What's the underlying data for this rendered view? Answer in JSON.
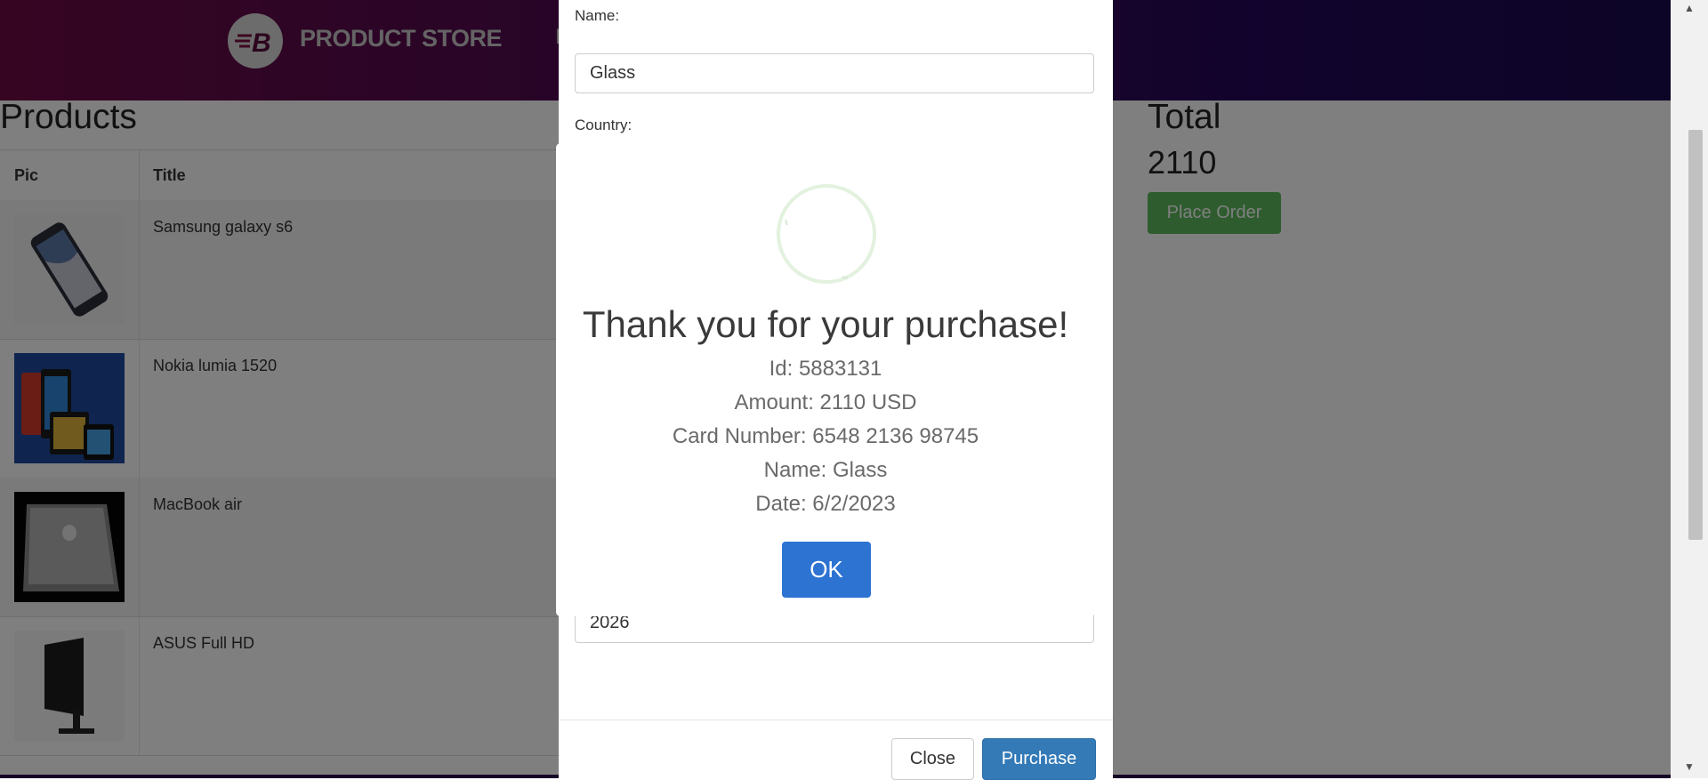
{
  "header": {
    "brand": "PRODUCT STORE",
    "nav_stub": "H",
    "logo_letter": "B"
  },
  "products": {
    "title": "Products",
    "columns": [
      "Pic",
      "Title"
    ],
    "rows": [
      {
        "title": "Samsung galaxy s6",
        "icon": "phone-icon"
      },
      {
        "title": "Nokia lumia 1520",
        "icon": "phone-icon"
      },
      {
        "title": "MacBook air",
        "icon": "laptop-icon"
      },
      {
        "title": "ASUS Full HD",
        "icon": "monitor-icon"
      }
    ]
  },
  "cart": {
    "total_label": "Total",
    "total_value": "2110",
    "place_order_label": "Place Order"
  },
  "order_modal": {
    "name_label": "Name:",
    "name_value": "Glass",
    "country_label": "Country:",
    "year_value": "2026",
    "close_label": "Close",
    "purchase_label": "Purchase"
  },
  "alert": {
    "title": "Thank you for your purchase!",
    "lines": [
      "Id: 5883131",
      "Amount: 2110 USD",
      "Card Number: 6548 2136 98745",
      "Name: Glass",
      "Date: 6/2/2023"
    ],
    "ok_label": "OK"
  },
  "colors": {
    "place_order": "#5cb85c",
    "purchase": "#337ab7",
    "ok": "#2d73d2"
  }
}
